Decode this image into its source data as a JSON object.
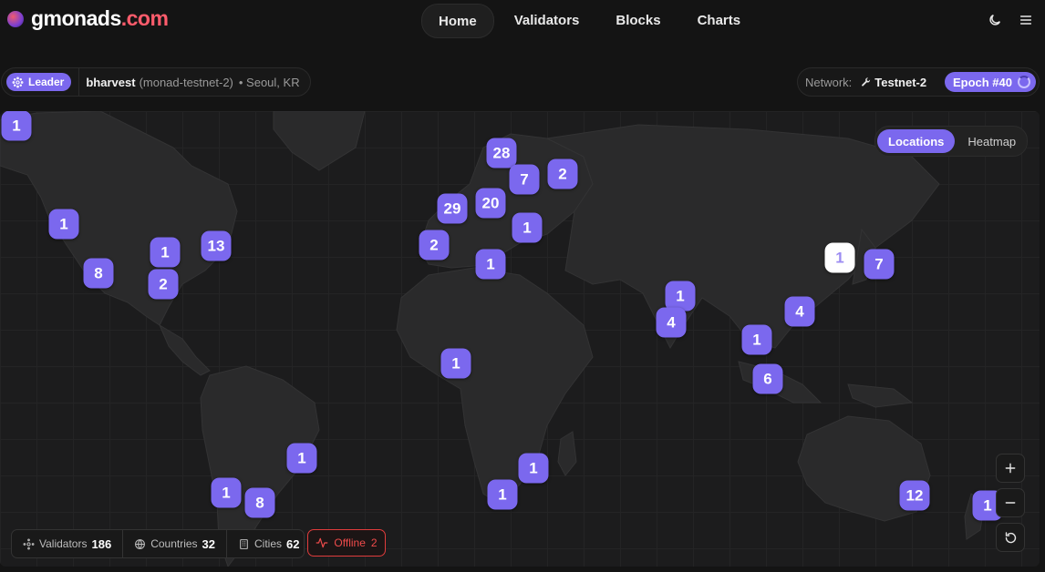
{
  "brand": {
    "name": "gmonads",
    "tld": ".com"
  },
  "nav": [
    {
      "label": "Home",
      "active": true
    },
    {
      "label": "Validators",
      "active": false
    },
    {
      "label": "Blocks",
      "active": false
    },
    {
      "label": "Charts",
      "active": false
    }
  ],
  "header_icons": [
    "theme-toggle-icon",
    "menu-icon"
  ],
  "leader": {
    "badge": "Leader",
    "name": "bharvest",
    "id": "(monad-testnet-2)",
    "location": "• Seoul, KR"
  },
  "network": {
    "label": "Network:",
    "value": "Testnet-2",
    "epoch": "Epoch #40"
  },
  "view_toggle": {
    "options": [
      "Locations",
      "Heatmap"
    ],
    "selected": "Locations"
  },
  "map_markers": [
    {
      "id": "alaska",
      "count": "1"
    },
    {
      "id": "us-northwest",
      "count": "1"
    },
    {
      "id": "us-west",
      "count": "8"
    },
    {
      "id": "us-central",
      "count": "1"
    },
    {
      "id": "us-south",
      "count": "2"
    },
    {
      "id": "us-east",
      "count": "13"
    },
    {
      "id": "scandinavia",
      "count": "28"
    },
    {
      "id": "baltics",
      "count": "7"
    },
    {
      "id": "russia-west",
      "count": "2"
    },
    {
      "id": "uk",
      "count": "29"
    },
    {
      "id": "germany",
      "count": "20"
    },
    {
      "id": "ukraine",
      "count": "1"
    },
    {
      "id": "iberia",
      "count": "2"
    },
    {
      "id": "italy-greece",
      "count": "1"
    },
    {
      "id": "seoul",
      "count": "1",
      "selected": true
    },
    {
      "id": "japan",
      "count": "7"
    },
    {
      "id": "india-north",
      "count": "1"
    },
    {
      "id": "india-west",
      "count": "4"
    },
    {
      "id": "taiwan",
      "count": "4"
    },
    {
      "id": "vietnam",
      "count": "1"
    },
    {
      "id": "singapore",
      "count": "6"
    },
    {
      "id": "west-africa",
      "count": "1"
    },
    {
      "id": "brazil",
      "count": "1"
    },
    {
      "id": "chile",
      "count": "1"
    },
    {
      "id": "argentina",
      "count": "8"
    },
    {
      "id": "southeast-africa",
      "count": "1"
    },
    {
      "id": "south-africa",
      "count": "1"
    },
    {
      "id": "australia",
      "count": "12"
    },
    {
      "id": "new-zealand",
      "count": "1"
    }
  ],
  "zoom_controls": [
    "zoom-in-icon",
    "zoom-out-icon",
    "reset-icon"
  ],
  "stats": {
    "validators_label": "Validators",
    "validators": "186",
    "countries_label": "Countries",
    "countries": "32",
    "cities_label": "Cities",
    "cities": "62"
  },
  "offline": {
    "label": "Offline",
    "count": "2"
  },
  "colors": {
    "accent": "#7b68ee",
    "brand_tld": "#ff5c6c",
    "offline": "#ef4b4b",
    "background": "#141414",
    "land": "#2a2a2b"
  }
}
